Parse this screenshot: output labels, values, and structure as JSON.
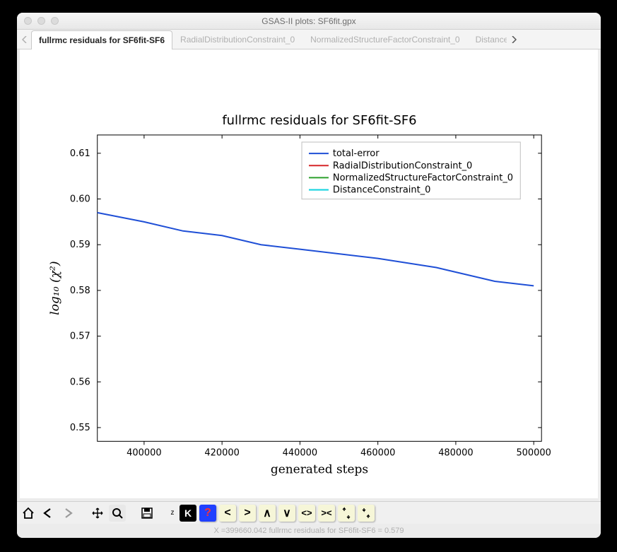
{
  "window": {
    "title": "GSAS-II plots: SF6fit.gpx"
  },
  "tabs": {
    "items": [
      {
        "label": "fullrmc residuals for SF6fit-SF6",
        "active": true
      },
      {
        "label": "RadialDistributionConstraint_0",
        "active": false
      },
      {
        "label": "NormalizedStructureFactorConstraint_0",
        "active": false
      },
      {
        "label": "Distance",
        "active": false
      }
    ]
  },
  "chart_data": {
    "type": "line",
    "title": "fullrmc residuals for SF6fit-SF6",
    "xlabel": "generated steps",
    "ylabel": "log₁₀ (χ²)",
    "xlim": [
      388000,
      502000
    ],
    "ylim": [
      0.547,
      0.614
    ],
    "xticks": [
      400000,
      420000,
      440000,
      460000,
      480000,
      500000
    ],
    "yticks": [
      0.55,
      0.56,
      0.57,
      0.58,
      0.59,
      0.6,
      0.61
    ],
    "series": [
      {
        "name": "total-error",
        "color": "#1f4fd6",
        "x": [
          388000,
          400000,
          410000,
          420000,
          425000,
          430000,
          440000,
          450000,
          460000,
          475000,
          490000,
          500000
        ],
        "y": [
          0.597,
          0.595,
          0.593,
          0.592,
          0.591,
          0.59,
          0.589,
          0.588,
          0.587,
          0.585,
          0.582,
          0.581
        ]
      },
      {
        "name": "RadialDistributionConstraint_0",
        "color": "#d62728",
        "x": [],
        "y": []
      },
      {
        "name": "NormalizedStructureFactorConstraint_0",
        "color": "#2ca02c",
        "x": [],
        "y": []
      },
      {
        "name": "DistanceConstraint_0",
        "color": "#17d4e0",
        "x": [],
        "y": []
      }
    ]
  },
  "toolbar": {
    "home": "Home",
    "back": "Back",
    "forward": "Fwd",
    "pan": "Pan",
    "zoom": "Zoom",
    "save": "Save",
    "btnZ": "z",
    "btnK": "K",
    "btnHelp": "?",
    "btnLt": "<",
    "btnGt": ">",
    "btnUp": "∧",
    "btnDn": "∨",
    "btnLR": "<>",
    "btnRL": "><",
    "btnUD": "↕",
    "btnDU": "↕"
  },
  "status": {
    "text": "X =399660.042 fullrmc residuals for SF6fit-SF6 =    0.579"
  }
}
